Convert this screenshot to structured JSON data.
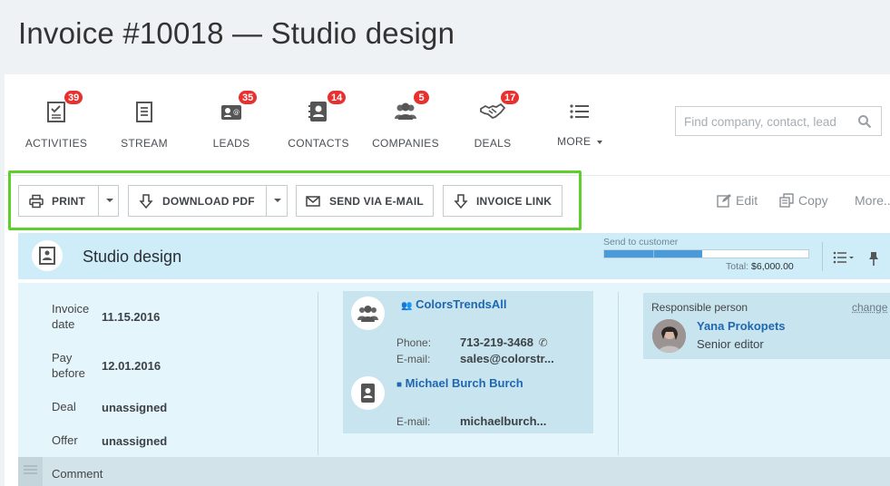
{
  "page": {
    "title": "Invoice #10018 — Studio design"
  },
  "nav": {
    "items": [
      {
        "label": "ACTIVITIES",
        "badge": "39",
        "icon": "activities-checklist-icon"
      },
      {
        "label": "STREAM",
        "badge": "",
        "icon": "stream-document-icon"
      },
      {
        "label": "LEADS",
        "badge": "35",
        "icon": "leads-card-icon"
      },
      {
        "label": "CONTACTS",
        "badge": "14",
        "icon": "contacts-book-icon"
      },
      {
        "label": "COMPANIES",
        "badge": "5",
        "icon": "companies-people-icon"
      },
      {
        "label": "DEALS",
        "badge": "17",
        "icon": "deals-handshake-icon"
      }
    ],
    "more_label": "MORE",
    "search_placeholder": "Find company, contact, lead"
  },
  "toolbar": {
    "print_label": "PRINT",
    "download_pdf_label": "DOWNLOAD PDF",
    "send_email_label": "SEND VIA E-MAIL",
    "invoice_link_label": "INVOICE LINK",
    "edit_label": "Edit",
    "copy_label": "Copy",
    "more_label": "More..."
  },
  "invoice": {
    "name": "Studio design",
    "stage_label": "Send to customer",
    "stage_progress_fraction": 0.48,
    "total_label": "Total:",
    "total_value": "$6,000.00",
    "fields": [
      {
        "label_line1": "Invoice",
        "label_line2": "date",
        "value": "11.15.2016"
      },
      {
        "label_line1": "Pay",
        "label_line2": "before",
        "value": "12.01.2016"
      },
      {
        "label_line1": "Deal",
        "label_line2": "",
        "value": "unassigned"
      },
      {
        "label_line1": "Offer",
        "label_line2": "",
        "value": "unassigned"
      }
    ],
    "company": {
      "name": "ColorsTrendsAll",
      "phone_label": "Phone:",
      "phone": "713-219-3468",
      "email_label": "E-mail:",
      "email": "sales@colorstr..."
    },
    "contact": {
      "name": "Michael Burch Burch",
      "email_label": "E-mail:",
      "email": "michaelburch..."
    },
    "responsible": {
      "label": "Responsible person",
      "change_label": "change",
      "name": "Yana Prokopets",
      "role": "Senior editor"
    },
    "comment_label": "Comment"
  }
}
